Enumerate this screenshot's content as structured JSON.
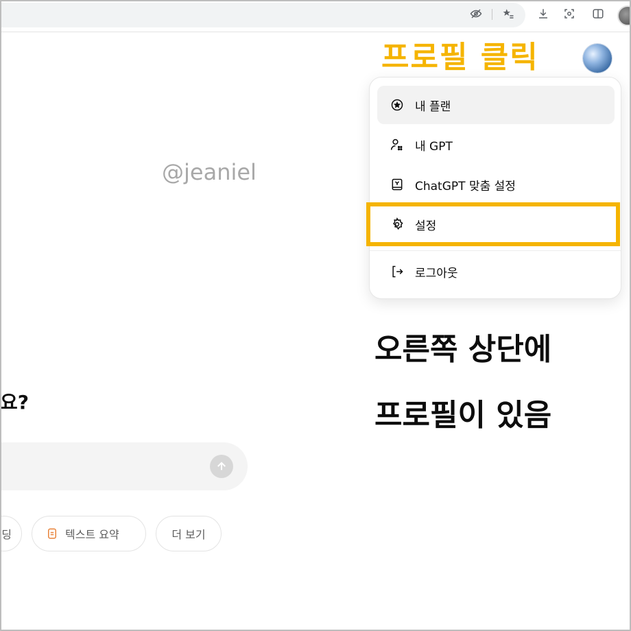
{
  "annotations": {
    "click_profile": "프로필 클릭",
    "line1": "오른쪽 상단에",
    "line2": "프로필이 있음",
    "watermark": "@jeaniel"
  },
  "menu": {
    "items": [
      {
        "label": "내 플랜",
        "icon": "plan-icon"
      },
      {
        "label": "내 GPT",
        "icon": "my-gpt-icon"
      },
      {
        "label": "ChatGPT 맞춤 설정",
        "icon": "customize-icon"
      },
      {
        "label": "설정",
        "icon": "settings-gear-icon"
      },
      {
        "label": "로그아웃",
        "icon": "logout-icon"
      }
    ]
  },
  "main": {
    "question_fragment": "요?",
    "suggestions": [
      {
        "label": "딩"
      },
      {
        "label": "텍스트 요약",
        "icon": "document-icon"
      },
      {
        "label": "더 보기"
      }
    ]
  },
  "colors": {
    "annotation_yellow": "#f5b400",
    "summary_icon": "#e8833a"
  }
}
